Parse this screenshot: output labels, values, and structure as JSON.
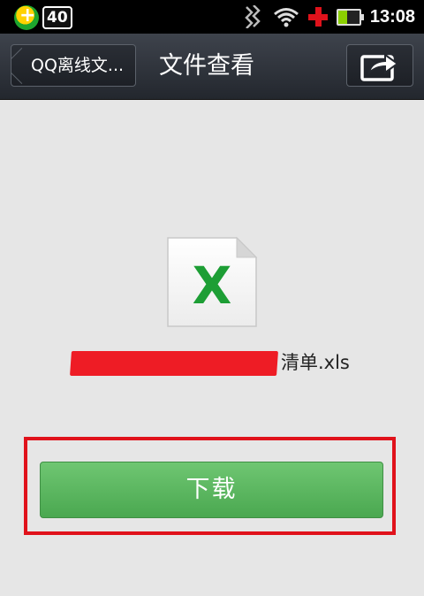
{
  "status_bar": {
    "badge_text": "40",
    "time": "13:08",
    "icons": [
      "app-badge-icon",
      "number-badge-icon",
      "data-signal-icon",
      "wifi-icon",
      "red-cross-icon",
      "battery-icon"
    ]
  },
  "title_bar": {
    "back_label": "QQ离线文...",
    "title": "文件查看",
    "share_icon": "share-icon"
  },
  "file": {
    "icon": "excel-file-icon",
    "icon_letter": "X",
    "name_suffix": "清单.xls",
    "name_redacted": true
  },
  "actions": {
    "download_label": "下载"
  },
  "colors": {
    "title_bar": "#2f333b",
    "background": "#e6e6e6",
    "download_green": "#5cb85f",
    "excel_green": "#1d9e35",
    "highlight_red": "#e0121b"
  }
}
